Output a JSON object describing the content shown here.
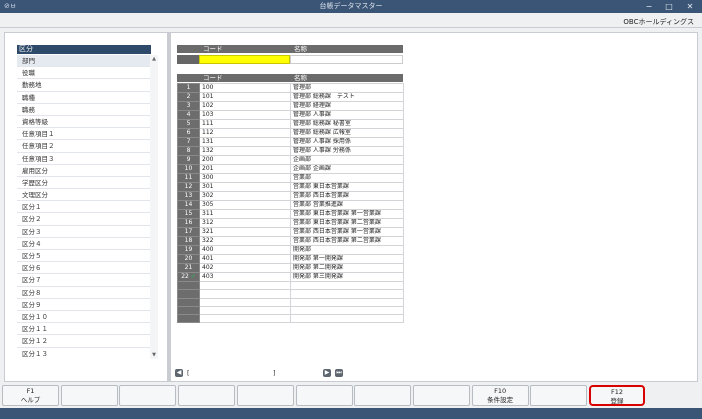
{
  "window": {
    "title": "台帳データマスター",
    "app_icon": "⊘ㅂ",
    "minimize": "−",
    "maximize": "□",
    "close": "✕"
  },
  "company": "OBCホールディングス",
  "left_panel": {
    "header": "区分",
    "items": [
      "部門",
      "役職",
      "勤務地",
      "職種",
      "職務",
      "資格等級",
      "任意項目１",
      "任意項目２",
      "任意項目３",
      "雇用区分",
      "学歴区分",
      "文理区分",
      "区分１",
      "区分２",
      "区分３",
      "区分４",
      "区分５",
      "区分６",
      "区分７",
      "区分８",
      "区分９",
      "区分１０",
      "区分１１",
      "区分１２",
      "区分１３"
    ],
    "scroll_up": "▲",
    "scroll_down": "▼"
  },
  "search": {
    "code_header": "コード",
    "name_header": "名称",
    "code_value": "",
    "name_value": ""
  },
  "table": {
    "code_header": "コード",
    "name_header": "名称",
    "rows": [
      {
        "num": "1",
        "code": "100",
        "name": "管理部"
      },
      {
        "num": "2",
        "code": "101",
        "name": "管理部 総務課　テスト"
      },
      {
        "num": "3",
        "code": "102",
        "name": "管理部 経理課"
      },
      {
        "num": "4",
        "code": "103",
        "name": "管理部 人事課"
      },
      {
        "num": "5",
        "code": "111",
        "name": "管理部 総務課 秘書室"
      },
      {
        "num": "6",
        "code": "112",
        "name": "管理部 総務課 広報室"
      },
      {
        "num": "7",
        "code": "131",
        "name": "管理部 人事課 採用係"
      },
      {
        "num": "8",
        "code": "132",
        "name": "管理部 人事課 労務係"
      },
      {
        "num": "9",
        "code": "200",
        "name": "企画部"
      },
      {
        "num": "10",
        "code": "201",
        "name": "企画部 企画課"
      },
      {
        "num": "11",
        "code": "300",
        "name": "営業部"
      },
      {
        "num": "12",
        "code": "301",
        "name": "営業部 東日本営業課"
      },
      {
        "num": "13",
        "code": "302",
        "name": "営業部 西日本営業課"
      },
      {
        "num": "14",
        "code": "305",
        "name": "営業部 営業推進課"
      },
      {
        "num": "15",
        "code": "311",
        "name": "営業部 東日本営業課 第一営業課"
      },
      {
        "num": "16",
        "code": "312",
        "name": "営業部 東日本営業課 第二営業課"
      },
      {
        "num": "17",
        "code": "321",
        "name": "営業部 西日本営業課 第一営業課"
      },
      {
        "num": "18",
        "code": "322",
        "name": "営業部 西日本営業課 第二営業課"
      },
      {
        "num": "19",
        "code": "400",
        "name": "開発部"
      },
      {
        "num": "20",
        "code": "401",
        "name": "開発部 第一開発課"
      },
      {
        "num": "21",
        "code": "402",
        "name": "開発部 第二開発課"
      },
      {
        "num": "22",
        "code": "403",
        "name": "開発部 第三開発課",
        "checked": true
      }
    ],
    "empty_rows": 5,
    "check_mark": "✔"
  },
  "pager": {
    "prev": "◀",
    "open_bracket": "[",
    "close_bracket": "]",
    "next": "▶",
    "last": "⏭"
  },
  "function_keys": [
    {
      "key": "F1",
      "label": "ヘルプ"
    },
    {
      "key": "",
      "label": ""
    },
    {
      "key": "",
      "label": ""
    },
    {
      "key": "",
      "label": ""
    },
    {
      "key": "",
      "label": ""
    },
    {
      "key": "",
      "label": ""
    },
    {
      "key": "",
      "label": ""
    },
    {
      "key": "",
      "label": ""
    },
    {
      "key": "F10",
      "label": "条件設定"
    },
    {
      "key": "",
      "label": ""
    },
    {
      "key": "F12",
      "label": "登録",
      "highlight": true
    }
  ],
  "colors": {
    "title_bar": "#3b5577",
    "panel_header": "#2e4a6a",
    "code_input": "#ffff00",
    "highlight_border": "#d90000"
  }
}
